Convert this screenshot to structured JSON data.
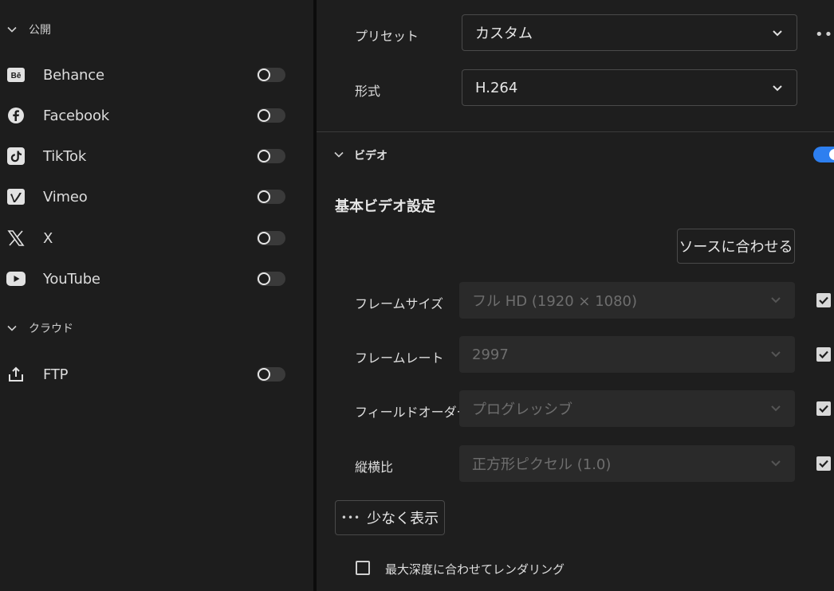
{
  "left_panel": {
    "publish_section": {
      "label": "公開",
      "chevron_icon": "chevron-down-icon"
    },
    "items": [
      {
        "label": "Behance",
        "icon": "behance-icon",
        "enabled": false
      },
      {
        "label": "Facebook",
        "icon": "facebook-icon",
        "enabled": false
      },
      {
        "label": "TikTok",
        "icon": "tiktok-icon",
        "enabled": false
      },
      {
        "label": "Vimeo",
        "icon": "vimeo-icon",
        "enabled": false
      },
      {
        "label": "X",
        "icon": "x-icon",
        "enabled": false
      },
      {
        "label": "YouTube",
        "icon": "youtube-icon",
        "enabled": false
      }
    ],
    "cloud_section": {
      "label": "クラウド",
      "chevron_icon": "chevron-down-icon"
    },
    "cloud_items": [
      {
        "label": "FTP",
        "icon": "upload-icon",
        "enabled": false
      }
    ]
  },
  "export_settings": {
    "preset": {
      "label": "プリセット",
      "value": "カスタム"
    },
    "format": {
      "label": "形式",
      "value": "H.264"
    },
    "more_icon": "more-horizontal-icon"
  },
  "video_section": {
    "label": "ビデオ",
    "enabled": true,
    "accent_color": "#2d7ff0",
    "basic_heading": "基本ビデオ設定",
    "match_source_button": "ソースに合わせる",
    "fields": [
      {
        "label": "フレームサイズ",
        "value": "フル HD (1920 × 1080)",
        "checked": true
      },
      {
        "label": "フレームレート",
        "value": "2997",
        "checked": true
      },
      {
        "label": "フィールドオーダー",
        "value": "プログレッシブ",
        "checked": true
      },
      {
        "label": "縦横比",
        "value": "正方形ピクセル (1.0)",
        "checked": true
      }
    ],
    "show_less_button": "少なく表示",
    "show_less_icon": "more-horizontal-icon",
    "max_depth_checkbox": {
      "label": "最大深度に合わせてレンダリング",
      "checked": false
    }
  }
}
